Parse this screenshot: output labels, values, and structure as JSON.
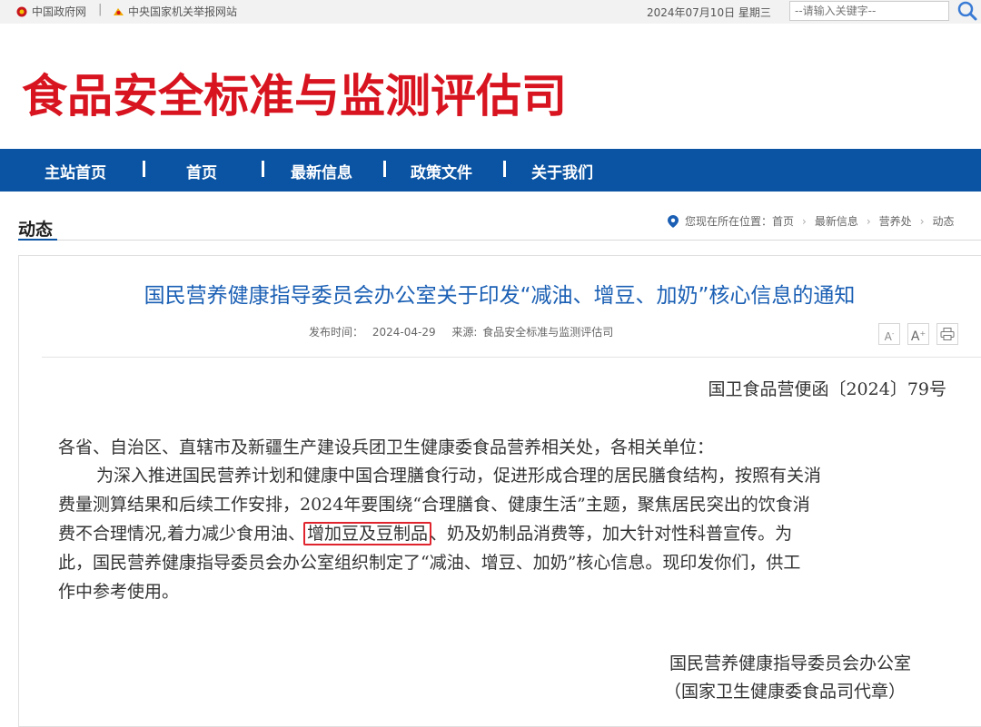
{
  "topbar": {
    "gov_link": "中国政府网",
    "sep": "|",
    "report_link": "中央国家机关举报网站",
    "date": "2024年07月10日 星期三",
    "search_placeholder": "--请输入关键字--"
  },
  "banner": {
    "title": "食品安全标准与监测评估司"
  },
  "nav": {
    "items": [
      "主站首页",
      "首页",
      "最新信息",
      "政策文件",
      "关于我们"
    ],
    "sep": "|"
  },
  "section": {
    "title": "动态",
    "breadcrumb": {
      "prefix": "您现在所在位置：",
      "items": [
        "首页",
        "最新信息",
        "营养处",
        "动态"
      ],
      "arrow": "›"
    }
  },
  "article": {
    "title": "国民营养健康指导委员会办公室关于印发“减油、增豆、加奶”核心信息的通知",
    "publish_label": "发布时间：",
    "publish_date": "2024-04-29",
    "source_label": "来源:",
    "source": "食品安全标准与监测评估司",
    "tools": {
      "font_smaller": "A",
      "font_larger": "A",
      "print": "print"
    },
    "doc_no": "国卫食品营便函〔2024〕79号",
    "salutation": "各省、自治区、直辖市及新疆生产建设兵团卫生健康委食品营养相关处，各相关单位：",
    "para_lines": [
      "为深入推进国民营养计划和健康中国合理膳食行动，促进形成合理的居民膳食结构，按照有关消",
      "费量测算结果和后续工作安排，2024年要围绕“合理膳食、健康生活”主题，聚焦居民突出的饮食消",
      "费不合理情况,着力减少食用油、",
      "增加豆及豆制品",
      "、奶及奶制品消费等，加大针对性科普宣传。为",
      "此，国民营养健康指导委员会办公室组织制定了“减油、增豆、加奶”核心信息。现印发你们，供工",
      "作中参考使用。"
    ],
    "signature": "国民营养健康指导委员会办公室",
    "seal_note": "（国家卫生健康委食品司代章）"
  },
  "colors": {
    "brand_red": "#d7141f",
    "nav_blue": "#0b54a3",
    "title_blue": "#1a5fb4",
    "highlight": "#e0242e"
  }
}
